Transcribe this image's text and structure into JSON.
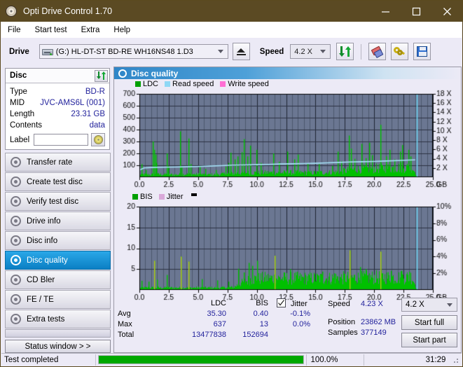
{
  "window": {
    "title": "Opti Drive Control 1.70",
    "icon": "disc-icon",
    "minimize": "minimize-icon",
    "maximize": "maximize-icon",
    "close": "close-icon"
  },
  "menu": {
    "items": [
      {
        "label": "File"
      },
      {
        "label": "Start test"
      },
      {
        "label": "Extra"
      },
      {
        "label": "Help"
      }
    ]
  },
  "toolbar": {
    "drive_label": "Drive",
    "drive_value": "(G:)  HL-DT-ST BD-RE  WH16NS48 1.D3",
    "eject_icon": "eject-icon",
    "speed_label": "Speed",
    "speed_value": "4.2 X",
    "refresh_icon": "refresh-icon",
    "eraser_icon": "eraser-icon",
    "key_icon": "key-icon",
    "save_icon": "save-icon"
  },
  "disc": {
    "group_title": "Disc",
    "refresh_icon": "refresh-icon",
    "rows": [
      {
        "key": "Type",
        "value": "BD-R"
      },
      {
        "key": "MID",
        "value": "JVC-AMS6L (001)"
      },
      {
        "key": "Length",
        "value": "23.31 GB"
      },
      {
        "key": "Contents",
        "value": "data"
      }
    ],
    "label_key": "Label",
    "label_value": "",
    "label_button_icon": "cd-icon"
  },
  "sidebar": {
    "items": [
      {
        "label": "Transfer rate",
        "active": false
      },
      {
        "label": "Create test disc",
        "active": false
      },
      {
        "label": "Verify test disc",
        "active": false
      },
      {
        "label": "Drive info",
        "active": false
      },
      {
        "label": "Disc info",
        "active": false
      },
      {
        "label": "Disc quality",
        "active": true
      },
      {
        "label": "CD Bler",
        "active": false
      },
      {
        "label": "FE / TE",
        "active": false
      },
      {
        "label": "Extra tests",
        "active": false
      }
    ],
    "status_window_label": "Status window > >"
  },
  "panel": {
    "title": "Disc quality",
    "icon": "disc-quality-icon"
  },
  "chart_data": [
    {
      "id": "ldc-chart",
      "type": "area",
      "title": "LDC / Read speed",
      "xlabel": "GB",
      "ylabel": "LDC",
      "xlim": [
        0,
        25
      ],
      "ylim": [
        0,
        700
      ],
      "y2lim": [
        0,
        18
      ],
      "y2label": "X",
      "grid": true,
      "legend_position": "top-left",
      "legend": [
        {
          "name": "LDC",
          "color": "#00a000"
        },
        {
          "name": "Read speed",
          "color": "#8fd8f5"
        },
        {
          "name": "Write speed",
          "color": "#ff6ed4"
        }
      ],
      "xticks": [
        "0.0",
        "2.5",
        "5.0",
        "7.5",
        "10.0",
        "12.5",
        "15.0",
        "17.5",
        "20.0",
        "22.5",
        "25.0"
      ],
      "xtick_values": [
        0,
        2.5,
        5,
        7.5,
        10,
        12.5,
        15,
        17.5,
        20,
        22.5,
        25
      ],
      "x_unit": "GB",
      "yticks": [
        "100",
        "200",
        "300",
        "400",
        "500",
        "600",
        "700"
      ],
      "ytick_values": [
        100,
        200,
        300,
        400,
        500,
        600,
        700
      ],
      "y2ticks": [
        "2 X",
        "4 X",
        "6 X",
        "8 X",
        "10 X",
        "12 X",
        "14 X",
        "16 X",
        "18 X"
      ],
      "y2tick_values": [
        2,
        4,
        6,
        8,
        10,
        12,
        14,
        16,
        18
      ],
      "series": [
        {
          "name": "LDC",
          "type": "impulse-area",
          "color": "#00c000",
          "baseline_x": [
            0,
            1,
            2,
            3,
            4,
            5,
            6,
            7,
            8,
            9,
            10,
            11,
            12,
            13,
            14,
            15,
            16,
            17,
            17.6,
            18.5,
            19.5,
            20.5,
            21.5,
            22.5,
            23.2,
            23.6
          ],
          "baseline_y": [
            22,
            20,
            22,
            20,
            24,
            22,
            20,
            24,
            30,
            34,
            34,
            36,
            34,
            36,
            34,
            34,
            36,
            40,
            52,
            62,
            66,
            70,
            72,
            76,
            78,
            20
          ],
          "spikes": [
            {
              "x": 0.15,
              "y": 110
            },
            {
              "x": 0.55,
              "y": 60
            },
            {
              "x": 1.15,
              "y": 300
            },
            {
              "x": 1.25,
              "y": 230
            },
            {
              "x": 1.35,
              "y": 190
            },
            {
              "x": 1.45,
              "y": 120
            },
            {
              "x": 2.35,
              "y": 200
            },
            {
              "x": 2.45,
              "y": 95
            },
            {
              "x": 3.45,
              "y": 385
            },
            {
              "x": 3.6,
              "y": 90
            },
            {
              "x": 4.2,
              "y": 325
            },
            {
              "x": 4.35,
              "y": 110
            },
            {
              "x": 5.15,
              "y": 95
            },
            {
              "x": 5.6,
              "y": 70
            },
            {
              "x": 6.5,
              "y": 60
            },
            {
              "x": 7.35,
              "y": 90
            },
            {
              "x": 7.6,
              "y": 120
            },
            {
              "x": 7.75,
              "y": 205
            },
            {
              "x": 8.1,
              "y": 150
            },
            {
              "x": 8.35,
              "y": 175
            },
            {
              "x": 8.7,
              "y": 210
            },
            {
              "x": 8.9,
              "y": 320
            },
            {
              "x": 9.2,
              "y": 175
            },
            {
              "x": 9.45,
              "y": 265
            },
            {
              "x": 9.95,
              "y": 230
            },
            {
              "x": 10.3,
              "y": 120
            },
            {
              "x": 11.4,
              "y": 200
            },
            {
              "x": 11.9,
              "y": 130
            },
            {
              "x": 12.6,
              "y": 215
            },
            {
              "x": 13.2,
              "y": 150
            },
            {
              "x": 13.5,
              "y": 190
            },
            {
              "x": 14.3,
              "y": 115
            },
            {
              "x": 15.3,
              "y": 110
            },
            {
              "x": 16.4,
              "y": 95
            },
            {
              "x": 16.9,
              "y": 215
            },
            {
              "x": 17.2,
              "y": 135
            },
            {
              "x": 17.85,
              "y": 350
            },
            {
              "x": 18.0,
              "y": 240
            },
            {
              "x": 18.3,
              "y": 155
            },
            {
              "x": 18.9,
              "y": 280
            },
            {
              "x": 19.3,
              "y": 160
            },
            {
              "x": 19.6,
              "y": 290
            },
            {
              "x": 19.8,
              "y": 185
            },
            {
              "x": 20.55,
              "y": 440
            },
            {
              "x": 21.0,
              "y": 175
            },
            {
              "x": 21.3,
              "y": 230
            },
            {
              "x": 21.7,
              "y": 150
            },
            {
              "x": 22.2,
              "y": 215
            },
            {
              "x": 22.4,
              "y": 270
            },
            {
              "x": 22.9,
              "y": 230
            },
            {
              "x": 23.1,
              "y": 175
            }
          ]
        },
        {
          "name": "Read speed",
          "type": "line",
          "color": "#a8e4fa",
          "axis": "right",
          "x": [
            0.05,
            0.4,
            1.0,
            2.0,
            3.0,
            4.0,
            5.0,
            6.0,
            7.0,
            8.0,
            9.0,
            10.0,
            11.0,
            12.0,
            13.0,
            14.0,
            15.0,
            16.0,
            17.0,
            18.0,
            19.0,
            20.0,
            21.0,
            22.0,
            23.0,
            23.5
          ],
          "y": [
            1.6,
            2.0,
            2.1,
            2.15,
            2.2,
            2.25,
            2.3,
            2.4,
            2.5,
            2.6,
            2.65,
            2.7,
            2.75,
            2.85,
            2.9,
            2.95,
            3.0,
            3.1,
            3.2,
            3.3,
            3.35,
            3.4,
            3.5,
            3.6,
            3.7,
            3.75
          ]
        },
        {
          "name": "scan-cursor",
          "type": "vline",
          "color": "#6fd6f5",
          "x": 23.6
        }
      ]
    },
    {
      "id": "bis-chart",
      "type": "area",
      "title": "BIS / Jitter",
      "xlabel": "GB",
      "ylabel": "BIS",
      "xlim": [
        0,
        25
      ],
      "ylim": [
        0,
        20
      ],
      "y2lim": [
        0,
        10
      ],
      "y2label": "%",
      "grid": true,
      "legend_position": "top-left",
      "legend": [
        {
          "name": "BIS",
          "color": "#00a000"
        },
        {
          "name": "Jitter",
          "color": "#d9a8d9"
        }
      ],
      "xticks": [
        "0.0",
        "2.5",
        "5.0",
        "7.5",
        "10.0",
        "12.5",
        "15.0",
        "17.5",
        "20.0",
        "22.5",
        "25.0"
      ],
      "xtick_values": [
        0,
        2.5,
        5,
        7.5,
        10,
        12.5,
        15,
        17.5,
        20,
        22.5,
        25
      ],
      "x_unit": "GB",
      "yticks": [
        "5",
        "10",
        "15",
        "20"
      ],
      "ytick_values": [
        5,
        10,
        15,
        20
      ],
      "y2ticks": [
        "2%",
        "4%",
        "6%",
        "8%",
        "10%"
      ],
      "y2tick_values": [
        2,
        4,
        6,
        8,
        10
      ],
      "series": [
        {
          "name": "BIS",
          "type": "impulse-area",
          "color": "#00c000",
          "baseline_x": [
            0,
            1,
            2,
            3,
            4,
            5,
            6,
            7,
            8,
            8.6,
            9.5,
            10.5,
            12,
            14,
            16,
            18,
            20,
            22,
            23.2,
            23.6
          ],
          "baseline_y": [
            0.5,
            0.5,
            0.5,
            0.5,
            0.5,
            0.5,
            0.5,
            0.5,
            0.6,
            1.5,
            2.4,
            2.6,
            2.6,
            2.6,
            2.6,
            2.7,
            2.8,
            2.8,
            2.9,
            0.4
          ],
          "spikes": [
            {
              "x": 0.2,
              "y": 2.2
            },
            {
              "x": 0.8,
              "y": 2.0
            },
            {
              "x": 1.25,
              "y": 7.0
            },
            {
              "x": 1.5,
              "y": 2.5
            },
            {
              "x": 2.3,
              "y": 3.6
            },
            {
              "x": 3.5,
              "y": 8.0
            },
            {
              "x": 4.15,
              "y": 6.8
            },
            {
              "x": 5.3,
              "y": 2.6
            },
            {
              "x": 6.6,
              "y": 2.3
            },
            {
              "x": 7.6,
              "y": 2.0
            },
            {
              "x": 8.4,
              "y": 5.1
            },
            {
              "x": 8.9,
              "y": 4.2
            },
            {
              "x": 9.3,
              "y": 6.5
            },
            {
              "x": 9.6,
              "y": 5.8
            },
            {
              "x": 10.0,
              "y": 7.0
            },
            {
              "x": 11.5,
              "y": 8.2
            },
            {
              "x": 12.8,
              "y": 5.0
            },
            {
              "x": 13.4,
              "y": 4.3
            },
            {
              "x": 15.6,
              "y": 4.4
            },
            {
              "x": 16.6,
              "y": 4.0
            },
            {
              "x": 17.9,
              "y": 9.5
            },
            {
              "x": 18.8,
              "y": 5.5
            },
            {
              "x": 19.3,
              "y": 5.0
            },
            {
              "x": 20.5,
              "y": 9.2
            },
            {
              "x": 21.4,
              "y": 4.6
            },
            {
              "x": 22.3,
              "y": 4.6
            },
            {
              "x": 23.0,
              "y": 4.4
            }
          ]
        },
        {
          "name": "scan-cursor",
          "type": "vline",
          "color": "#6fd6f5",
          "x": 23.6
        }
      ]
    }
  ],
  "stats": {
    "columns": [
      "LDC",
      "BIS"
    ],
    "rows": [
      {
        "label": "Avg",
        "ldc": "35.30",
        "bis": "0.40",
        "jitter": "-0.1%"
      },
      {
        "label": "Max",
        "ldc": "637",
        "bis": "13",
        "jitter": "0.0%"
      },
      {
        "label": "Total",
        "ldc": "13477838",
        "bis": "152694",
        "jitter": ""
      }
    ],
    "jitter_label": "Jitter",
    "jitter_checked": true,
    "speed_label": "Speed",
    "speed_value": "4.23 X",
    "position_label": "Position",
    "position_value": "23862 MB",
    "samples_label": "Samples",
    "samples_value": "377149",
    "speed_select": "4.2 X",
    "start_full_label": "Start full",
    "start_part_label": "Start part"
  },
  "statusbar": {
    "text": "Test completed",
    "progress_percent": 100.0,
    "progress_label": "100.0%",
    "elapsed": "31:29"
  },
  "colors": {
    "titlebar": "#5b4a23",
    "accent_blue": "#2f86c8",
    "chart_bg": "#6b7792",
    "green": "#00c000",
    "value_blue": "#23239c",
    "progress_green": "#00a800"
  }
}
